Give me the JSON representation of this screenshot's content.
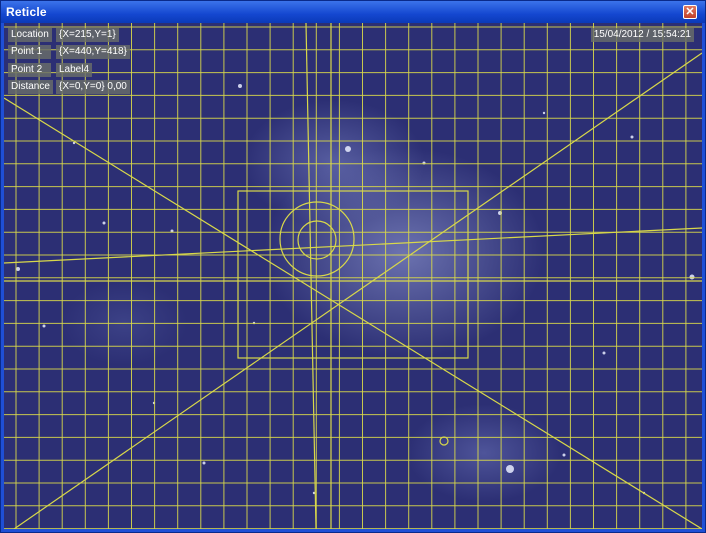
{
  "window": {
    "title": "Reticle",
    "close_glyph": "✕",
    "close_icon": "close-icon"
  },
  "readouts": {
    "location_label": "Location",
    "location_value": "{X=215,Y=1}",
    "point1_label": "Point 1",
    "point1_value": "{X=440,Y=418}",
    "point2_label": "Point 2",
    "point2_value": "Label4",
    "distance_label": "Distance",
    "distance_value": "{X=0,Y=0} 0,00",
    "timestamp": "15/04/2012 / 15:54:21"
  },
  "colors": {
    "grid": "#d8d84a",
    "titlebar": "#1f4fd6",
    "sky": "#2c2f74"
  }
}
